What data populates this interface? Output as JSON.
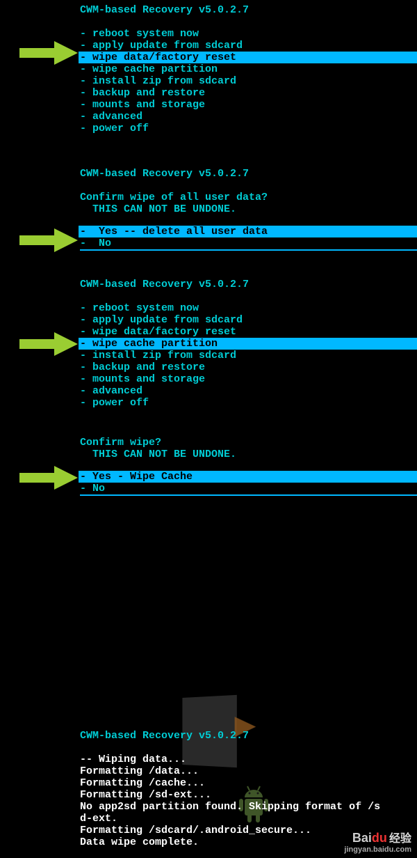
{
  "title": "CWM-based Recovery v5.0.2.7",
  "menu_items": [
    "- reboot system now",
    "- apply update from sdcard",
    "- wipe data/factory reset",
    "- wipe cache partition",
    "- install zip from sdcard",
    "- backup and restore",
    "- mounts and storage",
    "- advanced",
    "- power off"
  ],
  "panel1": {
    "selected_index": 2
  },
  "panel2": {
    "prompt1": "Confirm wipe of all user data?",
    "prompt2": "  THIS CAN NOT BE UNDONE.",
    "options": [
      "-  Yes -- delete all user data",
      "-  No"
    ],
    "selected_index": 0
  },
  "panel3": {
    "selected_index": 3
  },
  "panel4": {
    "prompt1": "Confirm wipe?",
    "prompt2": "  THIS CAN NOT BE UNDONE.",
    "options": [
      "- Yes - Wipe Cache",
      "- No"
    ],
    "selected_index": 0
  },
  "panel5": {
    "lines": [
      "-- Wiping data...",
      "Formatting /data...",
      "Formatting /cache...",
      "Formatting /sd-ext...",
      "No app2sd partition found. Skipping format of /s",
      "d-ext.",
      "Formatting /sdcard/.android_secure...",
      "Data wipe complete."
    ]
  },
  "watermark": {
    "brand": "Bai",
    "brand2": "du",
    "label": "经验",
    "url": "jingyan.baidu.com"
  }
}
